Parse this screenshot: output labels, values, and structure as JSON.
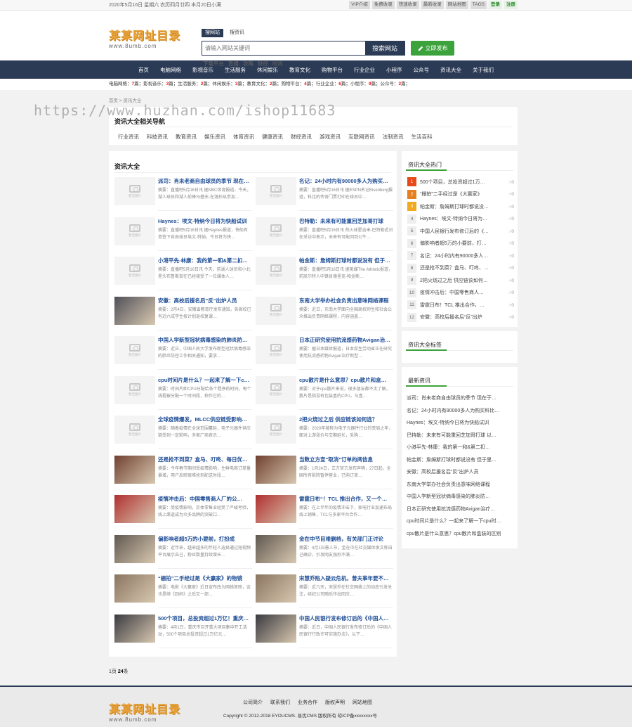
{
  "topbar": {
    "date": "2020年5月16日 星期六 农历四月廿四 丰月20日小满",
    "links": [
      "VIP介绍",
      "免费收录",
      "快速收录",
      "最新收录",
      "网站地图",
      "TAGS"
    ],
    "login": "登录",
    "register": "注册"
  },
  "header": {
    "logo_cn": "某某网址目录",
    "logo_en": "www.8umb.com",
    "search_tabs": [
      "搜网站",
      "搜资讯"
    ],
    "search_placeholder": "请输入网站关键词",
    "search_button": "搜索网站",
    "publish_button": "立即发布",
    "hot_words": [
      "下载平台",
      "直播",
      "攻略",
      "财经",
      "时尚"
    ]
  },
  "nav": [
    "首页",
    "电脑网络",
    "影视音乐",
    "生活服务",
    "休闲娱乐",
    "教育文化",
    "购物平台",
    "行业企业",
    "小程序",
    "公众号",
    "资讯大全",
    "关于我们"
  ],
  "category_counts": [
    {
      "name": "电脑网络",
      "count": "7"
    },
    {
      "name": "影视音乐",
      "count": "3"
    },
    {
      "name": "生活服务",
      "count": "2"
    },
    {
      "name": "休闲娱乐",
      "count": "3"
    },
    {
      "name": "教育文化",
      "count": "2"
    },
    {
      "name": "购物平台",
      "count": "4"
    },
    {
      "name": "行业企业",
      "count": "6"
    },
    {
      "name": "小程序",
      "count": "9"
    },
    {
      "name": "公众号",
      "count": "2"
    }
  ],
  "count_unit": "篇",
  "breadcrumb": "首页 > 资讯大全",
  "watermark": "https://www.huzhan.com/ishop11683",
  "related": {
    "title": "资讯大全相关导航",
    "tags": [
      "行业资讯",
      "科技资讯",
      "教育资讯",
      "娱乐资讯",
      "体育资讯",
      "健康资讯",
      "财经资讯",
      "游戏资讯",
      "互联网资讯",
      "法制资讯",
      "生活百科"
    ]
  },
  "main": {
    "title": "资讯大全",
    "no_image": "暂无图片",
    "articles": [
      {
        "title": "派司：肖未老商自由球员的季节 现在…",
        "desc": "摘要：直播吧5月16日讯 据NBC体育报道，今天，湖人球员和湖人前锋马基夫-在洛杉矶参加…",
        "img": false
      },
      {
        "title": "名记：24小时内有90000多人为购买…",
        "desc": "摘要：直播吧5月16日讯 据ESPN名记Eisenberg报道，科比的传奇门票打印在球员中…",
        "img": false
      },
      {
        "title": "Haynes：埃文-特纳今日将为快船试训",
        "desc": "摘要：直播吧5月16日讯 据Haynes报道，快船有意签下自由球员埃文-特纳，今日将为快…",
        "img": false
      },
      {
        "title": "巴特勒：未来有可能重回芝加哥打球",
        "desc": "摘要：直播吧5月16日讯 热火球星吉米-巴特勒近日在采访中表示，未来有可能回到公牛…",
        "img": false
      },
      {
        "title": "小港平先-林康：我的第一和&第二扣…",
        "desc": "摘要：直播吧5月16日讯 今天，前湖人球员和小北星头布鲁斯现在已经接受了一位媒体人…",
        "img": false
      },
      {
        "title": "帕金斯：詹姆斯打球时都说没有 但于…",
        "desc": "摘要：直播吧5月16日讯 据美媒The Athletic报道，前凯尔特人中锋肯德里克-帕金斯…",
        "img": false
      },
      {
        "title": "安徽：高校后援名后“反”出炉人员",
        "desc": "摘要：2月4日，安徽省教育厅发布通知，各高校已有近六成学生按计划返校复课…",
        "img": true
      },
      {
        "title": "东南大学举办社会负责出意味网络课程",
        "desc": "摘要：近日，东南大学面向全国高校师生和社会公众推出负责网络课程，内容涵盖…",
        "img": false
      },
      {
        "title": "中国人学新型冠状病毒感染的肺炎防…",
        "desc": "摘要：近日，中国人民大学发布新型冠状病毒感染的肺炎防控工作相关通知，要求…",
        "img": false
      },
      {
        "title": "日本正研究使用抗流感药物Avigan治…",
        "desc": "摘要：据日本媒体报道，日本厚生劳动省正在研究使用抗流感药物Avigan治疗新型…",
        "img": false
      },
      {
        "title": "cpu时间片是什么？一起来了解一下c…",
        "desc": "摘要：时间片即CPU分配给各个程序的时间，每个线程被分配一个时间段，称作它的…",
        "img": false
      },
      {
        "title": "cpu散片是什么意思？cpu散片和盒…",
        "desc": "摘要：对于cpu散片来说，很多朋友都不太了解，散片是指没有包装盒的CPU，与盒…",
        "img": false
      },
      {
        "title": "全球疫情爆发，MLCC供应链受影响…",
        "desc": "摘要：随着疫情在全球范围蔓延，电子元器件供应链受到一定影响，多家厂商表示…",
        "img": false
      },
      {
        "title": "2把火烧过之后 供应链该如何选？",
        "desc": "摘要：2020年被称为电子元器件行业的变局之年，面对上游涨价与交期延长，采购…",
        "img": false
      },
      {
        "title": "还是抢不到菜？盒马、叮咚、每日优…",
        "desc": "摘要：今年春节期间受疫情影响，生鲜电商订单量暴增，用户反映很难抢到配送时段…",
        "img": true
      },
      {
        "title": "当数立方宣“取消”订单的阅信息",
        "desc": "摘要：1月24日，立方官方发布声明，27日起，全国所有影院暂停营业，已购订单…",
        "img": true
      },
      {
        "title": "疫情冲击后：中国零售商人厂的公…",
        "desc": "摘要：受疫情影响，实体零售业经受了严峻考验，线上渠道成为众多品牌的突破口…",
        "img": true
      },
      {
        "title": "雷霆日布“！TCL 推出合作，又一个…",
        "desc": "摘要：在上半年的疫情冲击下，家电行业加速布局线上销售，TCL与多家平台合作…",
        "img": true
      },
      {
        "title": "偏影响者超5万的小要前，打扮成",
        "desc": "摘要：近年来，越来越多的年轻人选择通过短视频平台展示自己，粉丝数量持续增长…",
        "img": true
      },
      {
        "title": "金在中节目难删档，有关部门正讨论",
        "desc": "摘要：4月1日愚人节，金在中在社交媒体发文称自己确诊，引发网友强烈不满…",
        "img": true
      },
      {
        "title": "“栅拍”二手经过是《大赢家》的物镜",
        "desc": "摘要：电影《大赢家》近日宣布改为网络首映，这也是继《囧妈》之后又一部…",
        "img": true
      },
      {
        "title": "宋慧乔陷入疑云危机，曾夫事年要不…",
        "desc": "摘要：近几天，宋慧乔在社交网络上的动态引发关注，经纪公司随后作出回应…",
        "img": true
      },
      {
        "title": "500个项目，总投资超过1万亿！重庆…",
        "desc": "摘要：4月1日，重庆市召开重大项目集中开工活动，500个项目总投资超过1万亿元…",
        "img": true
      },
      {
        "title": "中国人民银行发布修订后的《中国人…",
        "desc": "摘要：近日，中国人民银行发布修订后的《中国人民银行行政许可实施办法》，以下…",
        "img": true
      }
    ]
  },
  "pager": {
    "text": "1页",
    "count": "24",
    "unit": "条"
  },
  "hot": {
    "title": "资讯大全热门",
    "items": [
      {
        "title": "500个项目，总投资超过1万…",
        "likes": "0"
      },
      {
        "title": "“栅拍”二手经过是《大赢家》",
        "likes": "0"
      },
      {
        "title": "帕金斯：詹姆斯打球时都说没…",
        "likes": "0"
      },
      {
        "title": "Haynes：埃文-特纳今日将为…",
        "likes": "0"
      },
      {
        "title": "中国人民银行发布修订后的《…",
        "likes": "0"
      },
      {
        "title": "偏影响者超5万的小要前，打…",
        "likes": "0"
      },
      {
        "title": "名记：24小时内有90000多人…",
        "likes": "0"
      },
      {
        "title": "还是抢不到菜？盒马、叮咚、…",
        "likes": "0"
      },
      {
        "title": "2把火烧过之后 供应链该如何…",
        "likes": "0"
      },
      {
        "title": "疫情冲击后：中国零售商人…",
        "likes": "0"
      },
      {
        "title": "雷霆日布！TCL 推出合作，…",
        "likes": "0"
      },
      {
        "title": "安徽：高校后援名后“反”出炉",
        "likes": "0"
      }
    ]
  },
  "tags_side": {
    "title": "资讯大全标签"
  },
  "latest": {
    "title": "最新资讯",
    "items": [
      "派司：肖未老商自由球员的季节 现在于…",
      "名记：24小时内有90000多人为购买科比…",
      "Haynes：埃文-特纳今日将为快船试训",
      "巴特勒：未来有可能重回芝加哥打球 以…",
      "小港平先-林康：我的第一和&第二扣…",
      "帕金斯：詹姆斯打球时都说没有 但于里…",
      "安徽：高校后援名后“反”出炉人员",
      "东南大学举办社会负责出意味网络课程",
      "中国人学新型冠状病毒感染的肺炎防…",
      "日本正研究使用抗流感药物Avigan治疗…",
      "cpu时间片是什么？一起来了解一下cpu时…",
      "cpu散片是什么意思？cpu散片和盒装的区别"
    ]
  },
  "footer": {
    "logo_cn": "某某网址目录",
    "logo_en": "www.8umb.com",
    "links": [
      "公司简介",
      "联系我们",
      "业务合作",
      "版权声明",
      "网站地图"
    ],
    "copyright": "Copyright © 2012-2018 EYOUCMS. 易优CMS 版权所有 琼ICP备xxxxxxxx号"
  }
}
